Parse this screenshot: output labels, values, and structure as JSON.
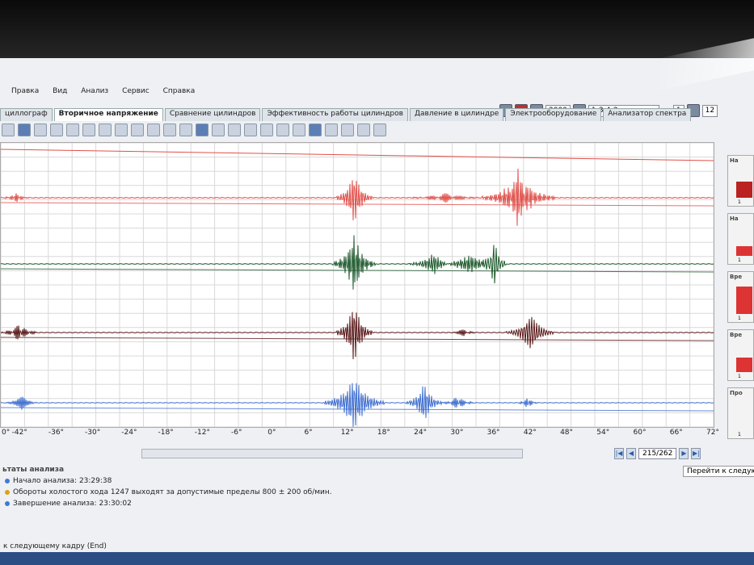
{
  "menubar": {
    "items": [
      "Правка",
      "Вид",
      "Анализ",
      "Сервис",
      "Справка"
    ]
  },
  "topright": {
    "rpm_value": "2000",
    "order_value": "1-3-4-2",
    "cyl_value": "1",
    "ch_value": "12"
  },
  "tabs": [
    "циллограф",
    "Вторичное напряжение",
    "Сравнение цилиндров",
    "Эффективность работы цилиндров",
    "Давление в цилиндре",
    "Электрооборудование",
    "Анализатор спектра"
  ],
  "toolbar": {
    "count": 24
  },
  "chart_data": {
    "type": "line",
    "x_ticks": [
      "-42°",
      "-36°",
      "-30°",
      "-24°",
      "-18°",
      "-12°",
      "-6°",
      "0°",
      "6°",
      "12°",
      "18°",
      "24°",
      "30°",
      "36°",
      "42°",
      "48°",
      "54°",
      "60°",
      "66°",
      "72°"
    ],
    "x_range": [
      -45,
      72
    ],
    "series": [
      {
        "name": "",
        "color": "#e0504a"
      },
      {
        "name": "",
        "color": "#1f5a2e"
      },
      {
        "name": "",
        "color": "#5a1a1a"
      },
      {
        "name": "",
        "color": "#3f6fd0"
      }
    ],
    "grid": true
  },
  "axis_prefix": "0°",
  "nav": {
    "frame": "215/262"
  },
  "tooltip": "Перейти к следующ",
  "panel": {
    "title": "ьтаты анализа",
    "lines": [
      "Начало анализа: 23:29:38",
      "Обороты холостого хода 1247 выходят за допустимые пределы 800 ± 200 об/мин.",
      "Завершение анализа: 23:30:02"
    ]
  },
  "status": "к следующему кадру (End)",
  "side": {
    "labels": [
      "На",
      "На",
      "Вре",
      "Вре",
      "Про"
    ]
  }
}
